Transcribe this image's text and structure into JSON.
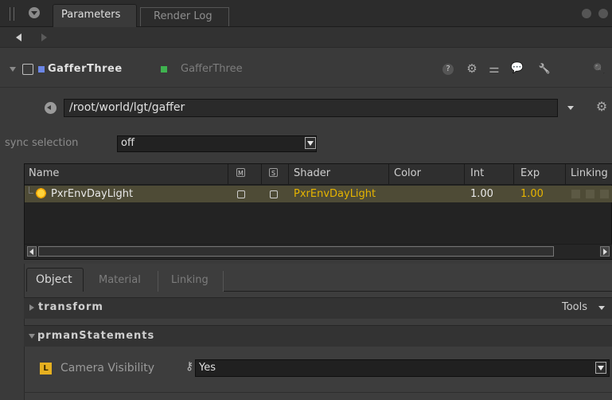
{
  "tabs": {
    "parameters": "Parameters",
    "render_log": "Render Log"
  },
  "node": {
    "name": "GafferThree",
    "type": "GafferThree"
  },
  "header_icons": {
    "help": "?",
    "gear": "⚙",
    "sliders": "⚌",
    "comment": "💬",
    "wrench": "🔧",
    "search": "🔍"
  },
  "path": {
    "value": "/root/world/lgt/gaffer",
    "gear": "⚙"
  },
  "sync": {
    "label": "sync selection",
    "value": "off"
  },
  "table": {
    "headers": {
      "name": "Name",
      "m": "M",
      "s": "S",
      "shader": "Shader",
      "color": "Color",
      "int": "Int",
      "exp": "Exp",
      "linking": "Linking"
    },
    "rows": [
      {
        "name": "PxrEnvDayLight",
        "shader": "PxrEnvDayLight",
        "int": "1.00",
        "exp": "1.00"
      }
    ]
  },
  "lower_tabs": {
    "object": "Object",
    "material": "Material",
    "linking": "Linking"
  },
  "groups": {
    "transform": {
      "label": "transform",
      "tools": "Tools"
    },
    "prman": {
      "label": "prmanStatements"
    }
  },
  "camera_visibility": {
    "badge": "L",
    "label": "Camera Visibility",
    "key": "⚷",
    "value": "Yes"
  },
  "colors": {
    "accent_yellow": "#e6b020",
    "node_blue": "#6b86e6",
    "node_green": "#3fb34f",
    "row_highlight": "#4e4b36"
  }
}
